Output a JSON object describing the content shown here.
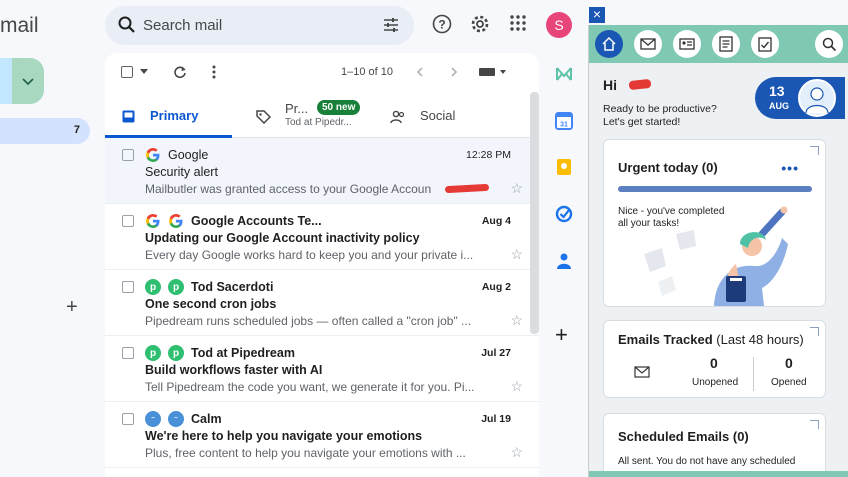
{
  "app": {
    "brand": "mail"
  },
  "search": {
    "placeholder": "Search mail"
  },
  "header": {
    "avatar_letter": "S"
  },
  "nav": {
    "active_count": "7"
  },
  "toolbar": {
    "pager": "1–10 of 10"
  },
  "tabs": {
    "primary": "Primary",
    "promotions": "Pr...",
    "promotions_badge": "50 new",
    "promotions_sub": "Tod at Pipedr...",
    "social": "Social"
  },
  "emails": [
    {
      "sender": "Google",
      "time": "12:28 PM",
      "subject": "Security alert",
      "snippet": "Mailbutler was granted access to your Google Accoun",
      "unread": false
    },
    {
      "sender": "Google Accounts Te...",
      "time": "Aug 4",
      "subject": "Updating our Google Account inactivity policy",
      "snippet": "Every day Google works hard to keep you and your private i...",
      "unread": true
    },
    {
      "sender": "Tod Sacerdoti",
      "time": "Aug 2",
      "subject": "One second cron jobs",
      "snippet": "Pipedream runs scheduled jobs — often called a \"cron job\" ...",
      "unread": true
    },
    {
      "sender": "Tod at Pipedream",
      "time": "Jul 27",
      "subject": "Build workflows faster with AI",
      "snippet": "Tell Pipedream the code you want, we generate it for you. Pi...",
      "unread": true
    },
    {
      "sender": "Calm",
      "time": "Jul 19",
      "subject": "We're here to help you navigate your emotions",
      "snippet": "Plus, free content to help you navigate your emotions with ...",
      "unread": true
    }
  ],
  "mailbutler": {
    "greeting": "Hi",
    "greeting_sub_1": "Ready to be productive?",
    "greeting_sub_2": "Let's get started!",
    "date_day": "13",
    "date_month": "AUG",
    "urgent_title": "Urgent today (0)",
    "urgent_msg_1": "Nice - you've completed",
    "urgent_msg_2": "all your tasks!",
    "tracked_title": "Emails Tracked",
    "tracked_period": "(Last 48 hours)",
    "unopened_count": "0",
    "unopened_label": "Unopened",
    "opened_count": "0",
    "opened_label": "Opened",
    "scheduled_title": "Scheduled Emails (0)",
    "scheduled_msg": "All sent. You do not have any scheduled"
  },
  "colors": {
    "accent": "#0b57d0",
    "mailbutler_blue": "#1a56b3",
    "mailbutler_teal": "#7fc9b4"
  }
}
